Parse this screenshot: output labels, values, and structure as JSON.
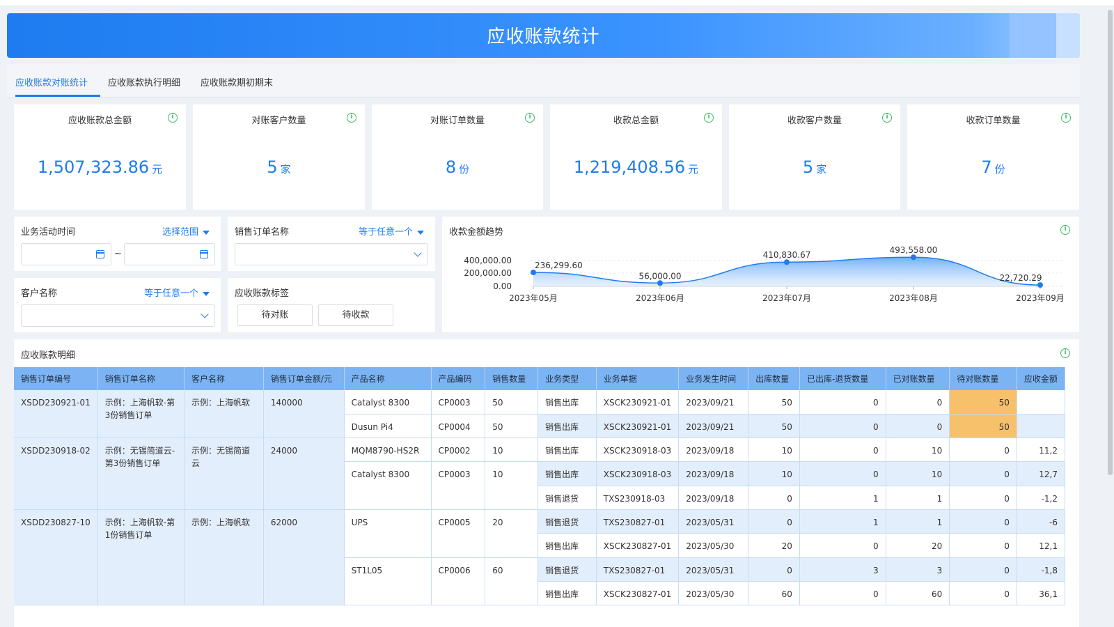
{
  "header": {
    "title": "应收账款统计"
  },
  "tabs": [
    "应收账款对账统计",
    "应收账款执行明细",
    "应收账款期初期末"
  ],
  "kpis": [
    {
      "label": "应收账款总金额",
      "value": "1,507,323.86",
      "unit": "元"
    },
    {
      "label": "对账客户数量",
      "value": "5",
      "unit": "家"
    },
    {
      "label": "对账订单数量",
      "value": "8",
      "unit": "份"
    },
    {
      "label": "收款总金额",
      "value": "1,219,408.56",
      "unit": "元"
    },
    {
      "label": "收款客户数量",
      "value": "5",
      "unit": "家"
    },
    {
      "label": "收款订单数量",
      "value": "7",
      "unit": "份"
    }
  ],
  "filters": {
    "activity_time": {
      "label": "业务活动时间",
      "link": "选择范围",
      "separator": "~"
    },
    "order_name": {
      "label": "销售订单名称",
      "link": "等于任意一个"
    },
    "customer": {
      "label": "客户名称",
      "link": "等于任意一个"
    },
    "tags": {
      "label": "应收账款标签",
      "buttons": [
        "待对账",
        "待收款"
      ]
    }
  },
  "chart_data": {
    "type": "area",
    "title": "收款金额趋势",
    "categories": [
      "2023年05月",
      "2023年06月",
      "2023年07月",
      "2023年08月",
      "2023年09月"
    ],
    "values": [
      236299.6,
      56000.0,
      410830.67,
      493558.0,
      22720.29
    ],
    "data_labels": [
      "236,299.60",
      "56,000.00",
      "410,830.67",
      "493,558.00",
      "22,720.29"
    ],
    "y_ticks": [
      "400,000.00",
      "200,000.00",
      "0.00"
    ],
    "ylim": [
      0,
      400000
    ],
    "color": "#1e7cf0",
    "grid": true
  },
  "detail": {
    "title": "应收账款明细",
    "columns": [
      "销售订单编号",
      "销售订单名称",
      "客户名称",
      "销售订单金额/元",
      "产品名称",
      "产品编码",
      "销售数量",
      "业务类型",
      "业务单据",
      "业务发生时间",
      "出库数量",
      "已出库-退货数量",
      "已对账数量",
      "待对账数量",
      "应收金额"
    ],
    "rows": [
      [
        "XSDD230921-01",
        "示例：上海帆软-第3份销售订单",
        "示例：上海帆软",
        "140000",
        "Catalyst 8300",
        "CP0003",
        "50",
        "销售出库",
        "XSCK230921-01",
        "2023/09/21",
        "50",
        "0",
        "0",
        "50",
        ""
      ],
      [
        "",
        "",
        "",
        "",
        "Dusun Pi4",
        "CP0004",
        "50",
        "销售出库",
        "XSCK230921-01",
        "2023/09/21",
        "50",
        "0",
        "0",
        "50",
        ""
      ],
      [
        "XSDD230918-02",
        "示例：无锡简道云-第3份销售订单",
        "示例：无锡简道云",
        "24000",
        "MQM8790-HS2R",
        "CP0002",
        "10",
        "销售出库",
        "XSCK230918-03",
        "2023/09/18",
        "10",
        "0",
        "10",
        "0",
        "11,2"
      ],
      [
        "",
        "",
        "",
        "",
        "Catalyst 8300",
        "CP0003",
        "10",
        "销售出库",
        "XSCK230918-03",
        "2023/09/18",
        "10",
        "0",
        "10",
        "0",
        "12,7"
      ],
      [
        "",
        "",
        "",
        "",
        "",
        "",
        "",
        "销售退货",
        "TXS230918-03",
        "2023/09/18",
        "0",
        "1",
        "1",
        "0",
        "-1,2"
      ],
      [
        "XSDD230827-10",
        "示例：上海帆软-第1份销售订单",
        "示例：上海帆软",
        "62000",
        "UPS",
        "CP0005",
        "20",
        "销售退货",
        "TXS230827-01",
        "2023/05/31",
        "0",
        "1",
        "1",
        "0",
        "-6"
      ],
      [
        "",
        "",
        "",
        "",
        "",
        "",
        "",
        "销售出库",
        "XSCK230827-01",
        "2023/05/30",
        "20",
        "0",
        "20",
        "0",
        "12,1"
      ],
      [
        "",
        "",
        "",
        "",
        "ST1L05",
        "CP0006",
        "60",
        "销售退货",
        "TXS230827-01",
        "2023/05/31",
        "0",
        "3",
        "3",
        "0",
        "-1,8"
      ],
      [
        "",
        "",
        "",
        "",
        "",
        "",
        "",
        "销售出库",
        "XSCK230827-01",
        "2023/05/30",
        "60",
        "0",
        "60",
        "0",
        "36,1"
      ]
    ]
  }
}
